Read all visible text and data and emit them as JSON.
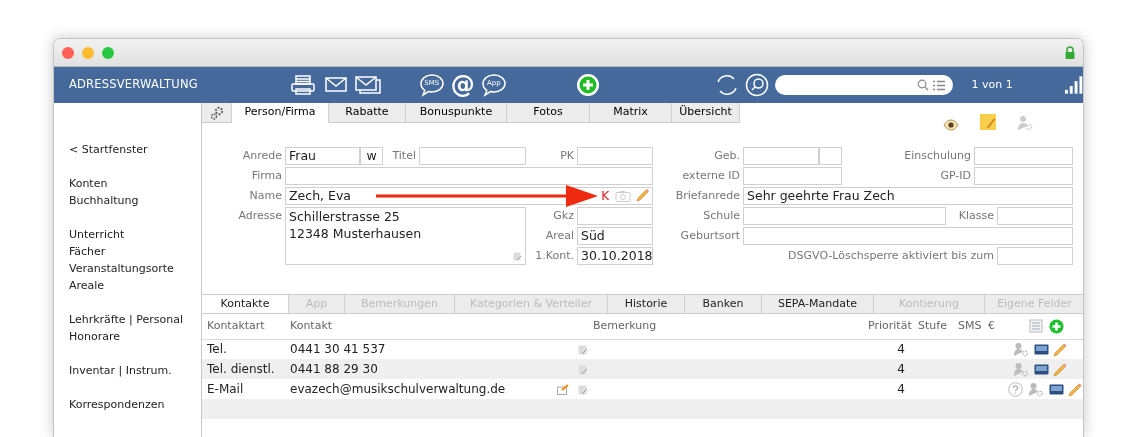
{
  "header": {
    "title": "ADRESSVERWALTUNG",
    "message_buttons": [
      "SMS",
      "@",
      "App"
    ],
    "record_counter": "1 von 1"
  },
  "sidebar": {
    "groups": [
      [
        "< Startfenster"
      ],
      [
        "Konten",
        "Buchhaltung"
      ],
      [
        "Unterricht",
        "Fächer",
        "Veranstaltungsorte",
        "Areale"
      ],
      [
        "Lehrkräfte | Personal",
        "Honorare"
      ],
      [
        "Inventar | Instrum."
      ],
      [
        "Korrespondenzen"
      ]
    ]
  },
  "tabs": [
    {
      "label": "Person/Firma",
      "selected": true
    },
    {
      "label": "Rabatte",
      "selected": false
    },
    {
      "label": "Bonuspunkte",
      "selected": false
    },
    {
      "label": "Fotos",
      "selected": false
    },
    {
      "label": "Matrix",
      "selected": false
    },
    {
      "label": "Übersicht",
      "selected": false
    }
  ],
  "person": {
    "anrede": {
      "label": "Anrede",
      "value": "Frau",
      "gender": "w"
    },
    "titel": {
      "label": "Titel"
    },
    "pk": {
      "label": "PK"
    },
    "firma": {
      "label": "Firma"
    },
    "name": {
      "label": "Name",
      "value": "Zech, Eva",
      "flag": "K"
    },
    "adresse": {
      "label": "Adresse",
      "lines": [
        "Schillerstrasse 25",
        "12348 Musterhausen"
      ]
    },
    "gkz": {
      "label": "Gkz"
    },
    "areal": {
      "label": "Areal",
      "value": "Süd"
    },
    "erster_kontakt": {
      "label": "1.Kont.",
      "value": "30.10.2018"
    },
    "geb": {
      "label": "Geb."
    },
    "einschulung": {
      "label": "Einschulung"
    },
    "externe_id": {
      "label": "externe ID"
    },
    "gp_id": {
      "label": "GP-ID"
    },
    "briefanrede": {
      "label": "Briefanrede",
      "value": "Sehr geehrte Frau Zech"
    },
    "schule": {
      "label": "Schule"
    },
    "klasse": {
      "label": "Klasse"
    },
    "geburtsort": {
      "label": "Geburtsort"
    },
    "dsgvo": {
      "label": "DSGVO-Löschsperre aktiviert bis zum"
    }
  },
  "detail_tabs": [
    {
      "label": "Kontakte",
      "selected": true,
      "disabled": false
    },
    {
      "label": "App",
      "selected": false,
      "disabled": true
    },
    {
      "label": "Bemerkungen",
      "selected": false,
      "disabled": true
    },
    {
      "label": "Kategorien & Verteiler",
      "selected": false,
      "disabled": true
    },
    {
      "label": "Historie",
      "selected": false,
      "disabled": false
    },
    {
      "label": "Banken",
      "selected": false,
      "disabled": false
    },
    {
      "label": "SEPA-Mandate",
      "selected": false,
      "disabled": false
    },
    {
      "label": "Kontierung",
      "selected": false,
      "disabled": true
    },
    {
      "label": "Eigene Felder",
      "selected": false,
      "disabled": true
    }
  ],
  "contacts": {
    "columns": [
      "Kontaktart",
      "Kontakt",
      "Bemerkung",
      "Priorität",
      "Stufe",
      "SMS",
      "€"
    ],
    "rows": [
      {
        "kind": "phone",
        "type": "Tel.",
        "contact": "0441 30 41 537",
        "priority": "4"
      },
      {
        "kind": "phone",
        "type": "Tel. dienstl.",
        "contact": "0441 88 29 30",
        "priority": "4"
      },
      {
        "kind": "email",
        "type": "E-Mail",
        "contact": "evazech@musikschulverwaltung.de",
        "priority": "4"
      }
    ]
  }
}
